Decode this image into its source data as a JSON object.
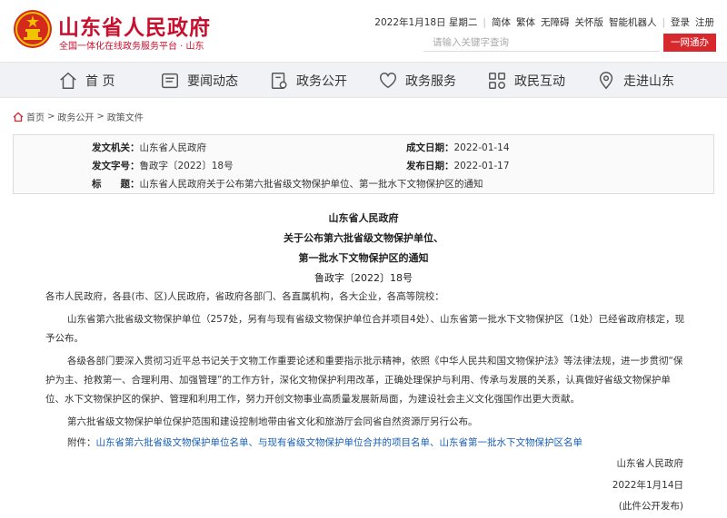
{
  "header": {
    "title": "山东省人民政府",
    "subtitle": "全国一体化在线政务服务平台 · 山东",
    "top_links": [
      "2022年1月18日 星期二",
      "|",
      "简体",
      "繁体",
      "无障碍",
      "关怀版",
      "智能机器人",
      "|",
      "登录",
      "注册"
    ],
    "search_placeholder": "请输入关键字查询",
    "search_button": "一网通办"
  },
  "nav": {
    "items": [
      {
        "label": "首 页",
        "icon": "home-icon"
      },
      {
        "label": "要闻动态",
        "icon": "news-icon"
      },
      {
        "label": "政务公开",
        "icon": "open-affairs-icon"
      },
      {
        "label": "政务服务",
        "icon": "service-icon"
      },
      {
        "label": "政民互动",
        "icon": "interaction-icon"
      },
      {
        "label": "走进山东",
        "icon": "location-icon"
      }
    ]
  },
  "breadcrumb": {
    "items": [
      "首页",
      "政务公开",
      "政策文件"
    ],
    "separator": ">"
  },
  "info": {
    "issuer_label": "发文机关：",
    "issuer": "山东省人民政府",
    "number_label": "发文字号：",
    "number": "鲁政字〔2022〕18号",
    "subject_label": "标　　题：",
    "subject": "山东省人民政府关于公布第六批省级文物保护单位、第一批水下文物保护区的通知",
    "created_label": "成文日期：",
    "created": "2022-01-14",
    "published_label": "发布日期：",
    "published": "2022-01-17"
  },
  "article": {
    "org": "山东省人民政府",
    "title_line1": "关于公布第六批省级文物保护单位、",
    "title_line2": "第一批水下文物保护区的通知",
    "doc_number": "鲁政字〔2022〕18号",
    "salutation": "各市人民政府，各县(市、区)人民政府，省政府各部门、各直属机构，各大企业，各高等院校：",
    "para1_line1": "山东省第六批省级文物保护单位（257处，另有与现有省级文物保护单位合并项目4处）、山东省第一批水下文物保护区（1处）已经省政府核定，现",
    "para1_line2": "予公布。",
    "para2_line1": "各级各部门要深入贯彻习近平总书记关于文物工作重要论述和重要指示批示精神，依照《中华人民共和国文物保护法》等法律法规，进一步贯彻“保",
    "para2_line2": "护为主、抢救第一、合理利用、加强管理”的工作方针，深化文物保护利用改革，正确处理保护与利用、传承与发展的关系，认真做好省级文物保护单",
    "para2_line3": "位、水下文物保护区的保护、管理和利用工作，努力开创文物事业高质量发展新局面，为建设社会主义文化强国作出更大贡献。",
    "para3": "第六批省级文物保护单位保护范围和建设控制地带由省文化和旅游厅会同省自然资源厅另行公布。",
    "attachment_label": "附件：",
    "attachments": [
      "山东省第六批省级文物保护单位名单",
      "、",
      "与现有省级文物保护单位合并的项目名单",
      "、",
      "山东省第一批水下文物保护区名单"
    ],
    "signature": "山东省人民政府",
    "date": "2022年1月14日",
    "note": "(此件公开发布)"
  }
}
